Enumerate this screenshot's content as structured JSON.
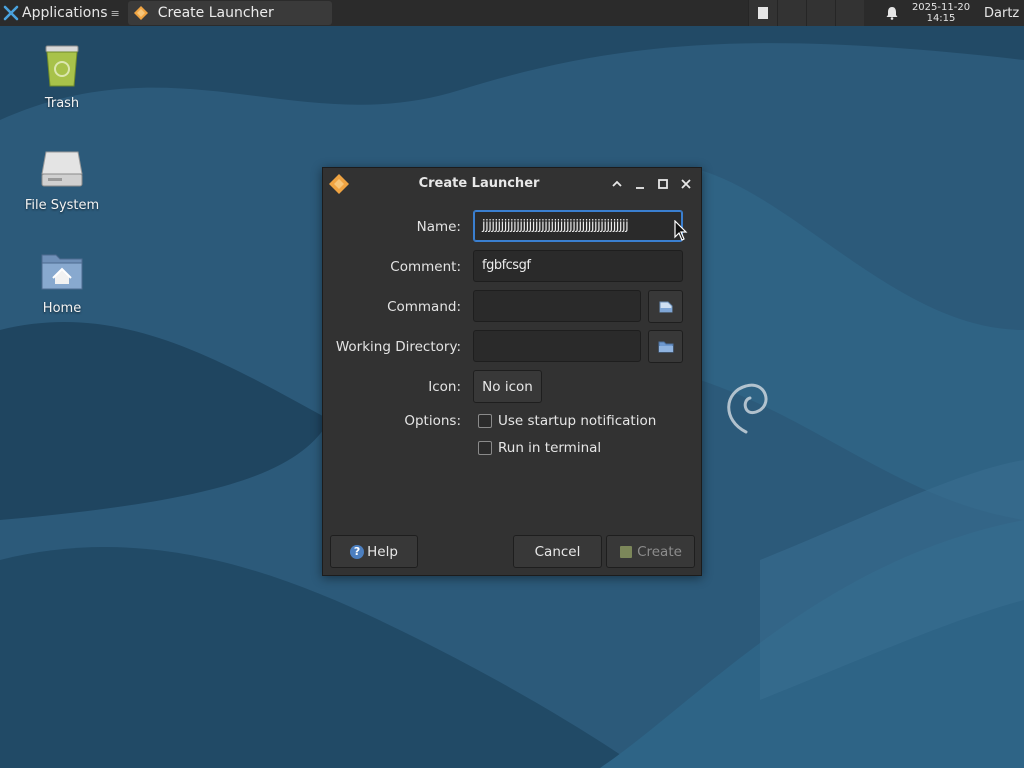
{
  "panel": {
    "applications_label": "Applications",
    "menu_arrow": "≡",
    "task_title": "Create Launcher",
    "clock_date": "2025-11-20",
    "clock_time": "14:15",
    "user": "Dartz"
  },
  "desktop_icons": [
    {
      "label": "Trash",
      "icon": "trash-icon"
    },
    {
      "label": "File System",
      "icon": "drive-icon"
    },
    {
      "label": "Home",
      "icon": "home-folder-icon"
    }
  ],
  "dialog": {
    "title": "Create Launcher",
    "labels": {
      "name": "Name:",
      "comment": "Comment:",
      "command": "Command:",
      "working_directory": "Working Directory:",
      "icon": "Icon:",
      "options": "Options:"
    },
    "fields": {
      "name_value": "jjjjjjjjjjjjjjjjjjjjjjjjjjjjjjjjjjjjjjjjjjjjjjj",
      "comment_value": "fgbfcsgf",
      "command_value": "",
      "working_directory_value": ""
    },
    "icon_button_label": "No icon",
    "options": {
      "startup_notification": {
        "label": "Use startup notification",
        "checked": false
      },
      "run_in_terminal": {
        "label": "Run in terminal",
        "checked": false
      }
    },
    "buttons": {
      "help": "Help",
      "help_glyph": "?",
      "cancel": "Cancel",
      "create": "Create"
    }
  },
  "colors": {
    "accent": "#3a7fd0",
    "dialog_bg": "#323232",
    "panel_bg": "#2b2b2b",
    "wallpaper": "#2a5878"
  }
}
